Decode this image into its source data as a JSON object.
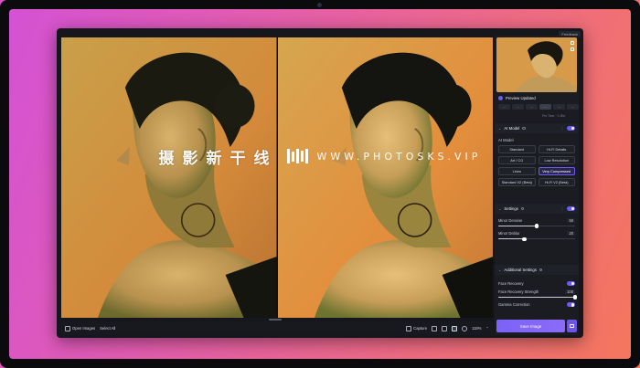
{
  "app": {
    "feedback_label": "Feedback"
  },
  "viewer": {
    "open_images_label": "Open Images",
    "select_all_label": "Select All",
    "capture_label": "Capture",
    "zoom_level": "118%"
  },
  "sidebar": {
    "preview_updated": "Preview Updated",
    "time_info": "Per Time: ~1.00s",
    "mini_buttons": [
      "—",
      "—",
      "—",
      "—",
      "—",
      "—"
    ],
    "ai_model": {
      "title": "AI Model",
      "label": "AI Model",
      "options": [
        "Standard",
        "Hi-Fi Details",
        "Art / CG",
        "Low Resolution",
        "Lines",
        "Very Compressed",
        "Standard V2 (Beta)",
        "Hi-Fi V2 (Beta)"
      ],
      "selected": "Very Compressed"
    },
    "settings": {
      "title": "Settings",
      "sliders": [
        {
          "label": "Minor Denoise",
          "value": "50",
          "fraction": 0.5
        },
        {
          "label": "Minor Deblur",
          "value": "20",
          "fraction": 0.34
        }
      ]
    },
    "additional": {
      "title": "Additional Settings",
      "face_recovery_label": "Face Recovery",
      "face_recovery_strength_label": "Face Recovery Strength",
      "face_recovery_strength_value": "100",
      "face_recovery_strength_fraction": 1.0,
      "gamma_label": "Gamma Correction"
    },
    "save_label": "Save Image"
  },
  "watermark": {
    "chinese": "摄影新干线",
    "url": "WWW.PHOTOSKS.VIP"
  },
  "colors": {
    "accent": "#6b5cf6",
    "background_gradient_start": "#d452d4",
    "background_gradient_end": "#f4765d"
  }
}
